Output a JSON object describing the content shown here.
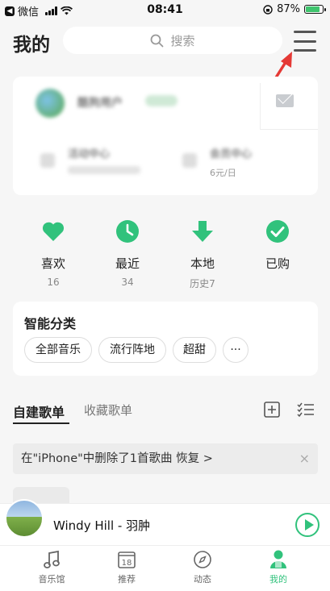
{
  "status_bar": {
    "carrier": "微信",
    "time": "08:41",
    "battery": "87%",
    "battery_level": 0.87
  },
  "header": {
    "title": "我的",
    "search_placeholder": "搜索"
  },
  "profile": {
    "username": "酷狗用户",
    "activity_label": "活动中心",
    "member_label": "会员中心",
    "member_price": "6元/日"
  },
  "quick_stats": [
    {
      "label": "喜欢",
      "count": "16"
    },
    {
      "label": "最近",
      "count": "34"
    },
    {
      "label": "本地",
      "count": "历史7"
    },
    {
      "label": "已购",
      "count": ""
    }
  ],
  "smart_classify": {
    "title": "智能分类",
    "chips": [
      "全部音乐",
      "流行阵地",
      "超甜",
      "···"
    ]
  },
  "playlist_tabs": {
    "active": "自建歌单",
    "inactive": "收藏歌单"
  },
  "notice": {
    "text": "在\"iPhone\"中删除了1首歌曲  恢复 >",
    "close": "×"
  },
  "player": {
    "song": "Windy Hill - 羽肿"
  },
  "bottom_nav": [
    {
      "label": "音乐馆"
    },
    {
      "label": "推荐",
      "badge": "18"
    },
    {
      "label": "动态"
    },
    {
      "label": "我的"
    }
  ],
  "colors": {
    "accent": "#31c27c",
    "red_arrow": "#e53935"
  }
}
